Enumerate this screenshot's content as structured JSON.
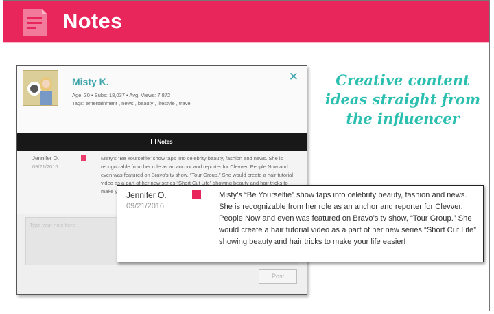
{
  "header": {
    "title": "Notes",
    "icon": "notes-document-icon"
  },
  "profile": {
    "name": "Misty K.",
    "stats": {
      "age_label": "Age:",
      "age": "30",
      "subs_label": "Subs:",
      "subs": "18,037",
      "views_label": "Avg. Views:",
      "views": "7,872",
      "separator": "•"
    },
    "tags_label": "Tags:",
    "tags": "entertainment , news , beauty , lifestyle , travel",
    "close": "✕"
  },
  "notes_tab": {
    "label": "Notes"
  },
  "note": {
    "author": "Jennifer O.",
    "date": "09/21/2016",
    "text": "Misty’s “Be Yourselfie” show taps into celebrity beauty, fashion and news. She is recognizable from her role as an anchor and reporter for Clevver, People Now and even was featured on Bravo’s tv show, “Tour Group.” She would create a hair tutorial video as a part of her new series “Short Cut Life” showing beauty and hair tricks to make your life easier!",
    "marker_color": "#e8265c"
  },
  "composer": {
    "placeholder": "Type your note here",
    "post_label": "Post"
  },
  "tagline": "Creative content ideas straight from the influencer",
  "colors": {
    "brand": "#e8265c",
    "accent": "#2a9ba0",
    "tagline": "#2bbfb0"
  }
}
